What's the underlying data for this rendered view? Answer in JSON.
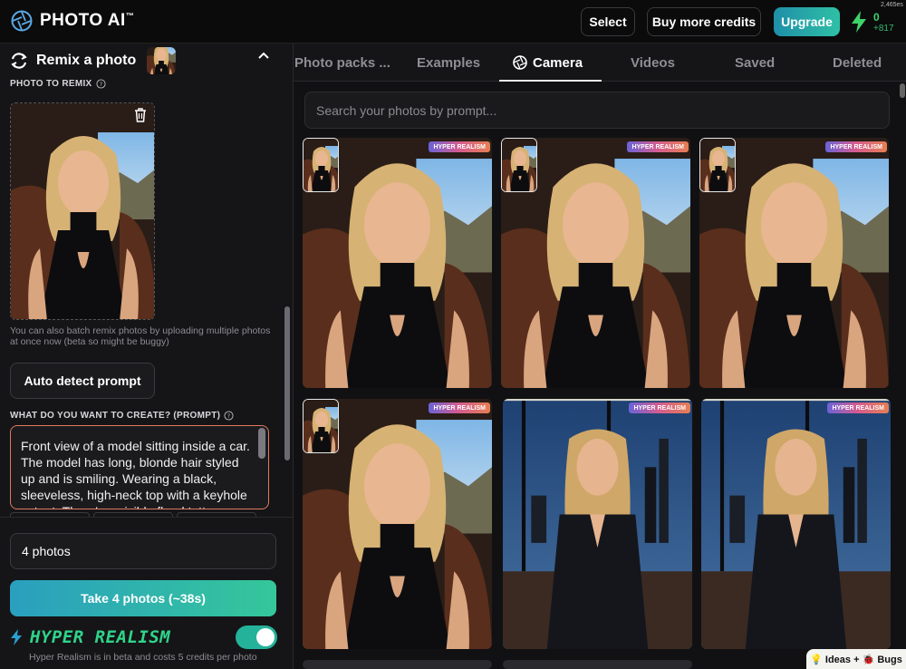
{
  "app": {
    "name": "PHOTO AI",
    "trademark": "™"
  },
  "header": {
    "select_label": "Select",
    "buy_credits_label": "Buy more credits",
    "upgrade_label": "Upgrade",
    "credits_small": "2,465es",
    "credits_value": "0",
    "credits_delta": "+817",
    "upgrade_colors": [
      "#1f8fa8",
      "#2fc0a6"
    ],
    "bolt_color": "#3ed36a"
  },
  "remix": {
    "title": "Remix a photo",
    "photo_label": "PHOTO TO REMIX",
    "batch_note": "You can also batch remix photos by uploading multiple photos at once now (beta so might be buggy)",
    "auto_detect_label": "Auto detect prompt",
    "prompt_label": "WHAT DO YOU WANT TO CREATE? (PROMPT)",
    "prompt_text": "Front view of a model sitting inside a car. The model has long, blonde hair styled up and is smiling. Wearing a black, sleeveless, high-neck top with a keyhole cutout. There's a visible floral tattoo on",
    "photos_count": "4 photos",
    "take_label": "Take 4 photos (~38s)",
    "hyper_logo": "HYPER REALISM",
    "hyper_enabled": true,
    "hyper_note": "Hyper Realism is in beta and costs 5 credits per photo"
  },
  "tabs": [
    {
      "label": "Photo packs ...",
      "active": false
    },
    {
      "label": "Examples",
      "active": false
    },
    {
      "label": "Camera",
      "active": true
    },
    {
      "label": "Videos",
      "active": false
    },
    {
      "label": "Saved",
      "active": false
    },
    {
      "label": "Deleted",
      "active": false
    }
  ],
  "search": {
    "placeholder": "Search your photos by prompt..."
  },
  "gallery": {
    "badge_label": "HYPER REALISM",
    "cards": [
      {
        "scene": "car",
        "has_reference": true
      },
      {
        "scene": "car",
        "has_reference": true
      },
      {
        "scene": "car",
        "has_reference": true
      },
      {
        "scene": "car",
        "has_reference": true
      },
      {
        "scene": "office",
        "has_reference": false
      },
      {
        "scene": "office",
        "has_reference": false
      }
    ]
  },
  "feedback": {
    "label": "💡 Ideas + 🐞 Bugs"
  }
}
